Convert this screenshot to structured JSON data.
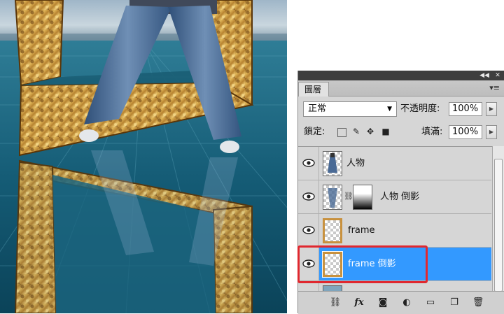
{
  "panel": {
    "tab_label": "圖層",
    "title_collapse_icon": "collapse-double-arrow-icon",
    "title_close_icon": "close-icon",
    "blend_mode": "正常",
    "opacity_label": "不透明度:",
    "opacity_value": "100%",
    "lock_label": "鎖定:",
    "fill_label": "填滿:",
    "fill_value": "100%"
  },
  "layers": [
    {
      "name": "人物",
      "visible": true,
      "selected": false
    },
    {
      "name": "人物 倒影",
      "visible": true,
      "selected": false,
      "has_mask": true
    },
    {
      "name": "frame",
      "visible": true,
      "selected": false
    },
    {
      "name": "frame 倒影",
      "visible": true,
      "selected": true
    }
  ],
  "footer_icons": [
    "link-layers-icon",
    "fx-icon",
    "add-mask-icon",
    "adjustment-layer-icon",
    "new-group-icon",
    "new-layer-icon",
    "trash-icon"
  ],
  "footer": {
    "fx_label": "fx"
  },
  "colors": {
    "selection": "#3399ff",
    "highlight_box": "#e0282f"
  }
}
